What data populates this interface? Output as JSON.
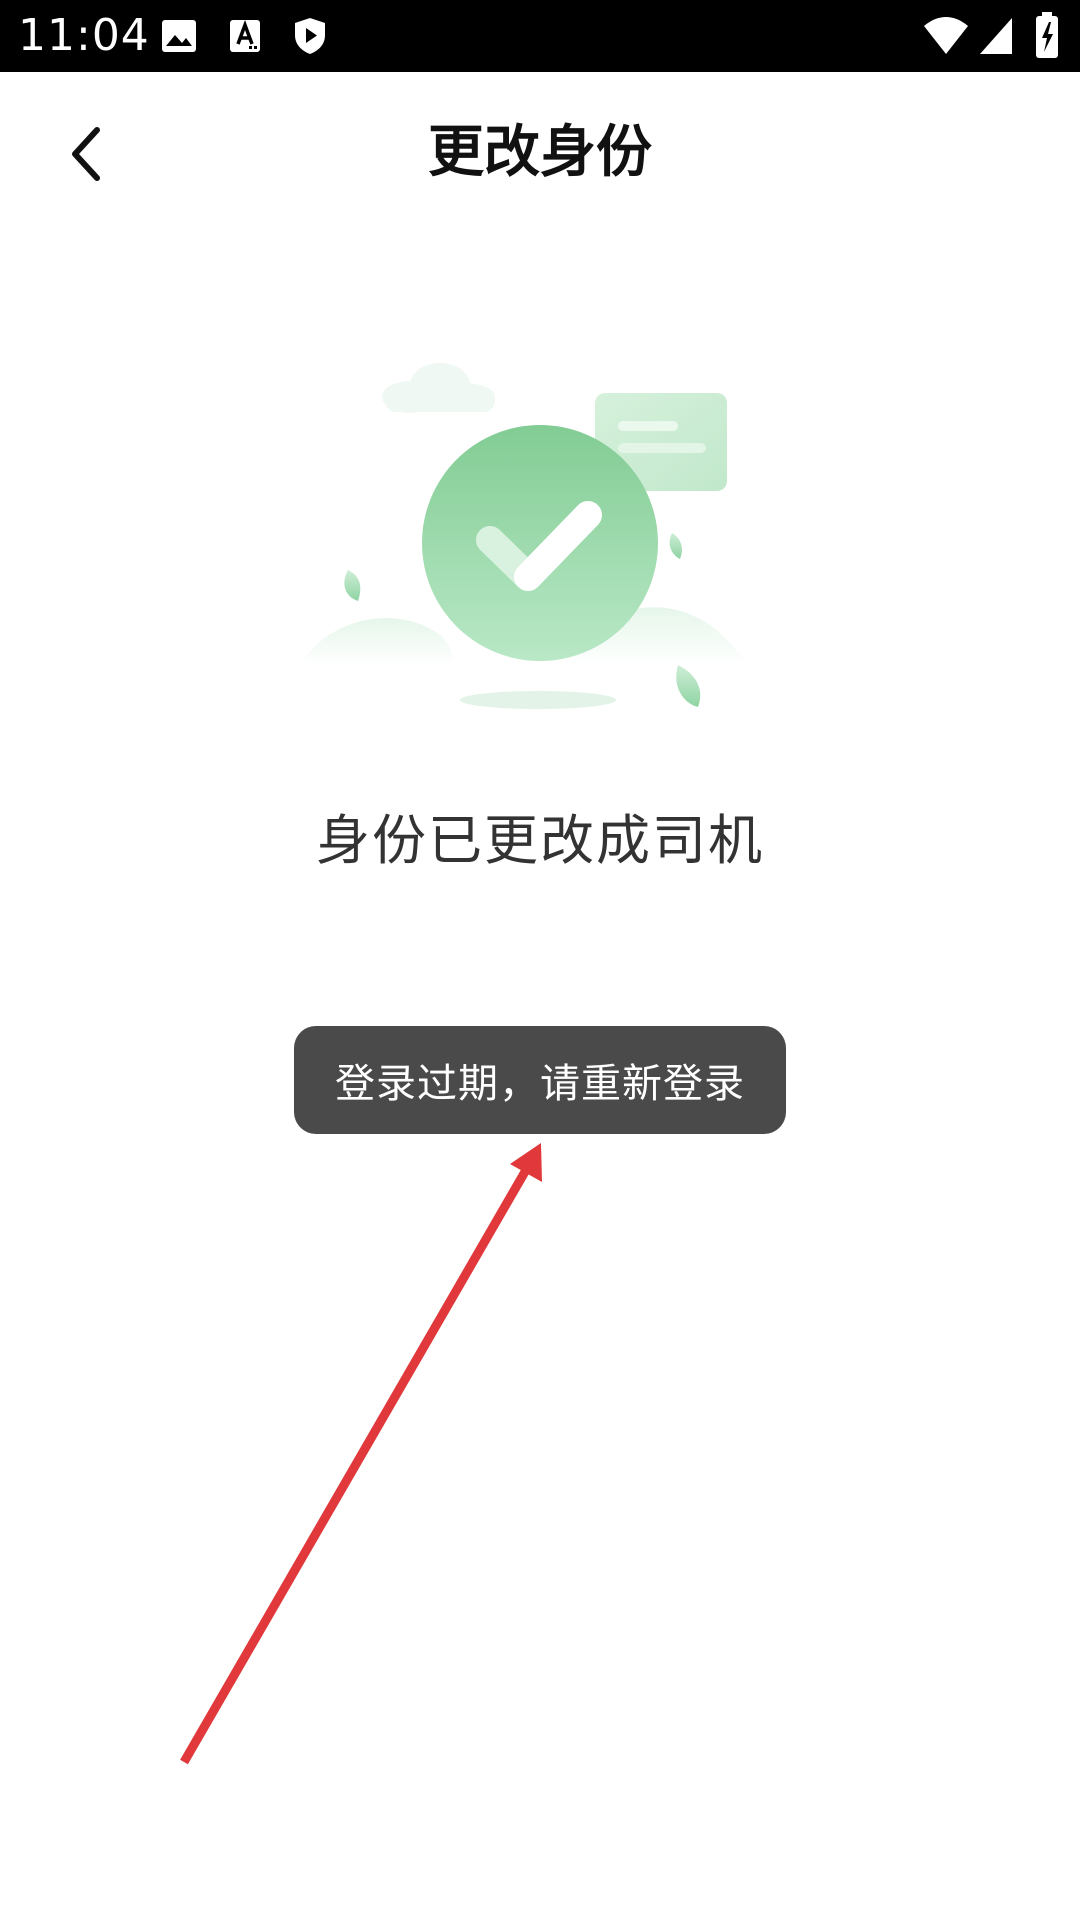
{
  "status_bar": {
    "time": "11:04",
    "icons": [
      "image-icon",
      "a-text-icon",
      "shield-play-icon",
      "wifi-icon",
      "cellular-signal-icon",
      "battery-charging-icon"
    ]
  },
  "header": {
    "title": "更改身份",
    "back_icon": "chevron-left-icon"
  },
  "main": {
    "illustration": "success-check-illustration",
    "message": "身份已更改成司机"
  },
  "toast": {
    "message": "登录过期，请重新登录"
  },
  "annotation": {
    "arrow_icon": "red-arrow-icon",
    "color": "#e0383b"
  },
  "colors": {
    "accent_green": "#8fd4a3",
    "toast_bg": "#4a4a4a"
  }
}
